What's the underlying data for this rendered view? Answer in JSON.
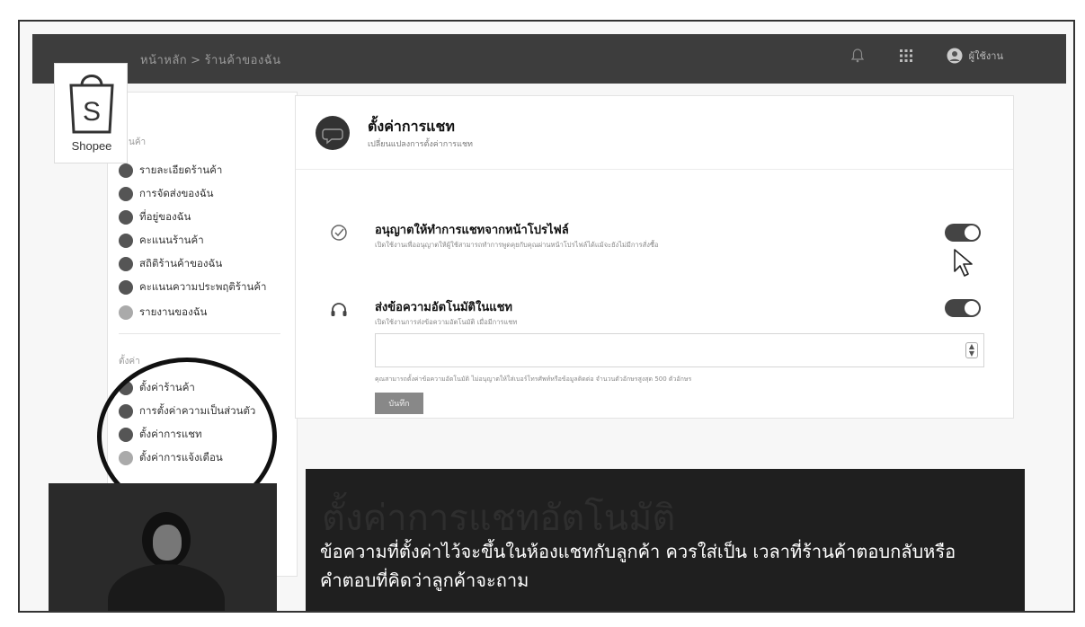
{
  "header": {
    "breadcrumb_home": "หน้าหลัก",
    "breadcrumb_separator": ">",
    "breadcrumb_current": "ร้านค้าของฉัน",
    "user_name": "ผู้ใช้งาน",
    "icons": [
      "bell-icon",
      "apps-grid-icon",
      "user-avatar-icon"
    ]
  },
  "logo": {
    "text": "Shopee",
    "letter": "S",
    "color": "#333333"
  },
  "sidebar": {
    "section1_label": "ร้านค้า",
    "items": [
      {
        "label": "รายละเอียดร้านค้า"
      },
      {
        "label": "การจัดส่งของฉัน"
      },
      {
        "label": "ที่อยู่ของฉัน"
      },
      {
        "label": "คะแนนร้านค้า"
      },
      {
        "label": "สถิติร้านค้าของฉัน"
      },
      {
        "label": "คะแนนความประพฤติร้านค้า"
      },
      {
        "label": "รายงานของฉัน"
      }
    ],
    "section2_label": "ตั้งค่า",
    "settings_items": [
      {
        "label": "ตั้งค่าร้านค้า"
      },
      {
        "label": "การตั้งค่าความเป็นส่วนตัว"
      },
      {
        "label": "ตั้งค่าการแชท"
      },
      {
        "label": "ตั้งค่าการแจ้งเตือน"
      }
    ]
  },
  "card": {
    "title": "ตั้งค่าการแชท",
    "subtitle": "เปลี่ยนแปลงการตั้งค่าการแชท",
    "rows": [
      {
        "title": "อนุญาตให้ทำการแชทจากหน้าโปรไฟล์",
        "description": "เปิดใช้งานเพื่ออนุญาตให้ผู้ใช้สามารถทำการพูดคุยกับคุณผ่านหน้าโปรไฟล์ได้แม้จะยังไม่มีการสั่งซื้อ",
        "enabled": true,
        "icon": "check-circle-icon"
      },
      {
        "title": "ส่งข้อความอัตโนมัติในแชท",
        "description": "เปิดใช้งานการส่งข้อความอัตโนมัติ เมื่อมีการแชท",
        "enabled": true,
        "icon": "headset-icon"
      }
    ],
    "message_value": "",
    "note": "คุณสามารถตั้งค่าข้อความอัตโนมัติ ไม่อนุญาตให้ใส่เบอร์โทรศัพท์หรือข้อมูลติดต่อ จำนวนตัวอักษรสูงสุด 500 ตัวอักษร",
    "save_label": "บันทึก"
  },
  "caption": {
    "faded_title": "ตั้งค่าการแชทอัตโนมัติ",
    "line1": "ข้อความที่ตั้งค่าไว้จะขึ้นในห้องแชทกับลูกค้า ควรใส่เป็น เวลาที่ร้านค้าตอบกลับหรือ",
    "line2": "คำตอบที่คิดว่าลูกค้าจะถาม"
  }
}
